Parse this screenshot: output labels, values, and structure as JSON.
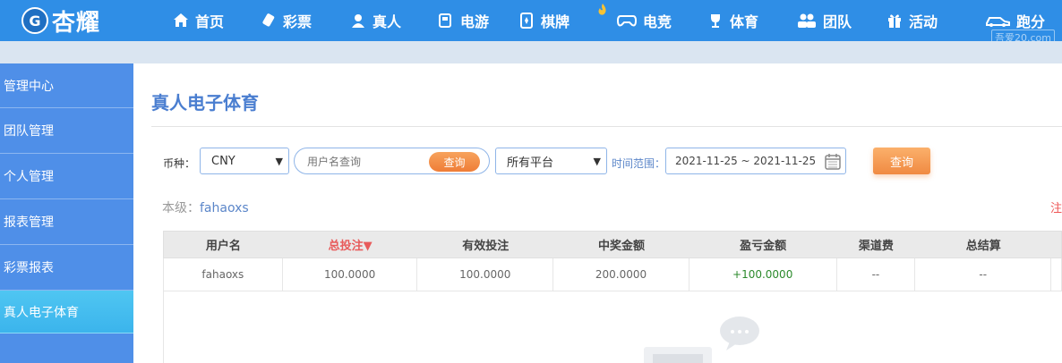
{
  "brand": {
    "logo_mark": "G",
    "logo_text": "杏耀"
  },
  "nav": [
    {
      "label": "首页",
      "icon": "home-icon"
    },
    {
      "label": "彩票",
      "icon": "lottery-icon"
    },
    {
      "label": "真人",
      "icon": "live-dealer-icon"
    },
    {
      "label": "电游",
      "icon": "slot-game-icon"
    },
    {
      "label": "棋牌",
      "icon": "poker-card-icon",
      "hot": true
    },
    {
      "label": "电竞",
      "icon": "gamepad-icon"
    },
    {
      "label": "体育",
      "icon": "trophy-icon"
    },
    {
      "label": "团队",
      "icon": "team-icon"
    },
    {
      "label": "活动",
      "icon": "gift-icon"
    },
    {
      "label": "跑分",
      "icon": "car-icon"
    }
  ],
  "watermark": "吾爱20.com",
  "sidebar": {
    "items": [
      {
        "label": "管理中心",
        "active": false
      },
      {
        "label": "团队管理",
        "active": false
      },
      {
        "label": "个人管理",
        "active": false
      },
      {
        "label": "报表管理",
        "active": false
      },
      {
        "label": "彩票报表",
        "active": false
      },
      {
        "label": "真人电子体育",
        "active": true
      }
    ]
  },
  "page": {
    "title": "真人电子体育"
  },
  "filters": {
    "currency_label": "币种：",
    "currency_value": "CNY",
    "username_placeholder": "用户名查询",
    "search_button": "查询",
    "platform_value": "所有平台",
    "time_label": "时间范围：",
    "date_range": "2021-11-25 ~ 2021-11-25",
    "query_button": "查询"
  },
  "level": {
    "label": "本级：",
    "value": "fahaoxs"
  },
  "edge_mark": "注",
  "table": {
    "headers": [
      "用户名",
      "总投注▼",
      "有效投注",
      "中奖金额",
      "盈亏金额",
      "渠道费",
      "总结算"
    ],
    "rows": [
      [
        "fahaoxs",
        "100.0000",
        "100.0000",
        "200.0000",
        "+100.0000",
        "--",
        "--"
      ]
    ]
  },
  "colors": {
    "topbar": "#2f8ee6",
    "sidebar": "#4f8fe8",
    "sidebar_active": "#3bb4ec",
    "accent_orange": "#f08a42",
    "title_blue": "#4a7ed0",
    "sort_red": "#e85b5b",
    "profit_green": "#2c8a2c"
  }
}
